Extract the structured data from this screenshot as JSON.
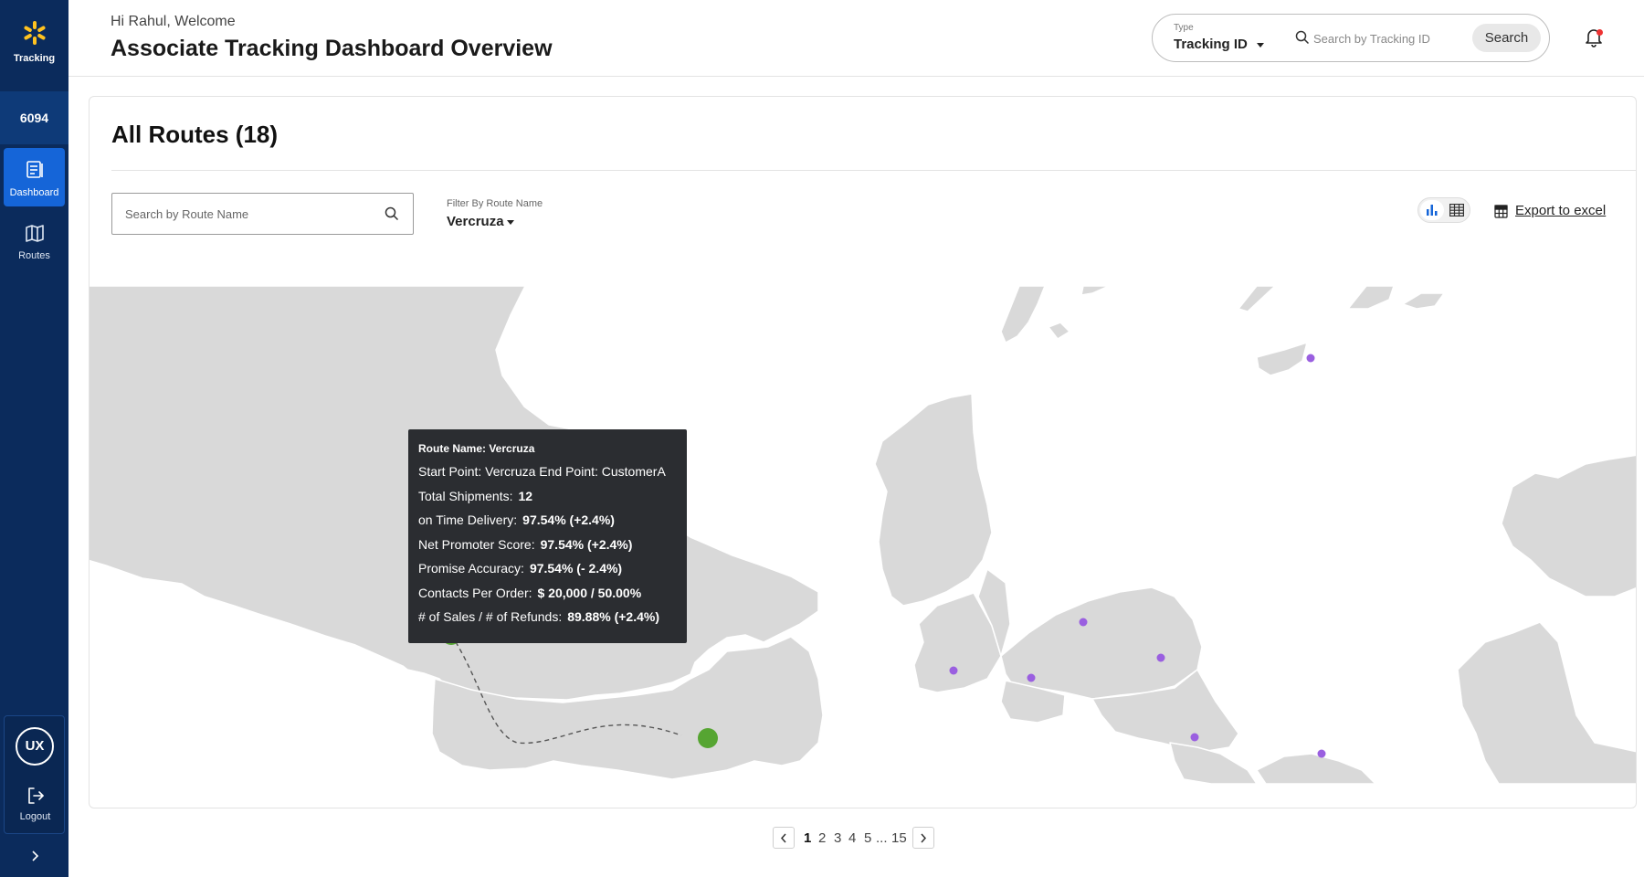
{
  "sidebar": {
    "brand_label": "Tracking",
    "store_number": "6094",
    "items": [
      {
        "label": "Dashboard",
        "active": true
      },
      {
        "label": "Routes",
        "active": false
      }
    ],
    "user_initials": "UX",
    "logout_label": "Logout"
  },
  "header": {
    "greeting": "Hi Rahul, Welcome",
    "title": "Associate Tracking Dashboard Overview",
    "type_label": "Type",
    "type_value": "Tracking  ID",
    "search_placeholder": "Search by Tracking ID",
    "search_button": "Search"
  },
  "card": {
    "title": "All Routes (18)",
    "route_search_placeholder": "Search by Route Name",
    "filter_label": "Filter By Route Name",
    "filter_value": "Vercruza",
    "export_label": "Export to excel"
  },
  "tooltip": {
    "title": "Route Name: Vercruza",
    "points": "Start Point: Vercruza  End Point: CustomerA",
    "rows": [
      {
        "label": "Total Shipments:",
        "value": "12"
      },
      {
        "label": "on Time Delivery:",
        "value": "97.54% (+2.4%)"
      },
      {
        "label": "Net Promoter Score:",
        "value": "97.54% (+2.4%)"
      },
      {
        "label": "Promise Accuracy:",
        "value": "97.54% (- 2.4%)"
      },
      {
        "label": "Contacts Per Order:",
        "value": "$ 20,000 / 50.00%"
      },
      {
        "label": "# of Sales / # of Refunds:",
        "value": "89.88% (+2.4%)"
      }
    ]
  },
  "pagination": {
    "pages": [
      "1",
      "2",
      "3",
      "4",
      "5",
      "...",
      "15"
    ],
    "current": "1"
  },
  "colors": {
    "sidebar_bg": "#0b2b5c",
    "active_nav": "#1565d8",
    "route_point": "#56a532",
    "location_dot": "#9a5fe0",
    "land": "#d9d9d9",
    "brand_spark": "#ffc220"
  }
}
